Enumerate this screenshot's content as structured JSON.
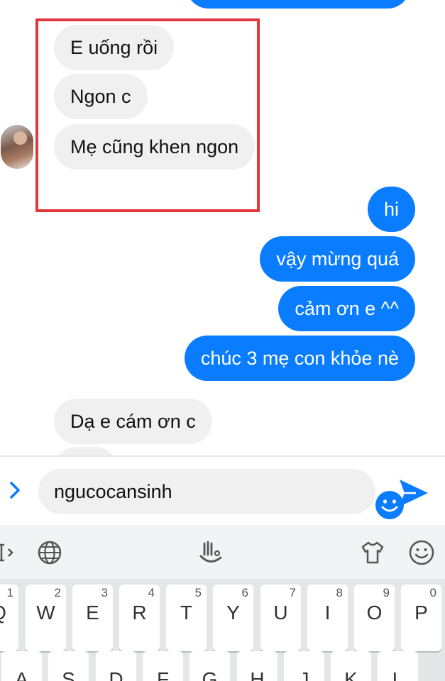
{
  "chat": {
    "incoming_top": [
      {
        "text": "E uống rồi"
      },
      {
        "text": "Ngon c"
      },
      {
        "text": "Mẹ cũng khen ngon"
      }
    ],
    "outgoing": [
      {
        "text": "hi"
      },
      {
        "text": "vậy mừng quá"
      },
      {
        "text": "cảm ơn e ^^"
      },
      {
        "text": "chúc 3 mẹ con khỏe nè"
      }
    ],
    "incoming_bottom": [
      {
        "text": "Dạ e cám ơn c"
      }
    ]
  },
  "composer": {
    "input_value": "ngucocansinh",
    "icons": [
      "chevron-right-icon",
      "emoji-icon",
      "send-icon"
    ]
  },
  "keyboard": {
    "toolbar_icons": [
      "cursor-icon",
      "globe-icon",
      "gesture-icon",
      "shirt-icon",
      "smiley-icon"
    ],
    "row1": [
      {
        "letter": "Q",
        "hint": "1"
      },
      {
        "letter": "W",
        "hint": "2"
      },
      {
        "letter": "E",
        "hint": "3"
      },
      {
        "letter": "R",
        "hint": "4"
      },
      {
        "letter": "T",
        "hint": "5"
      },
      {
        "letter": "Y",
        "hint": "6"
      },
      {
        "letter": "U",
        "hint": "7"
      },
      {
        "letter": "I",
        "hint": "8"
      },
      {
        "letter": "O",
        "hint": "9"
      },
      {
        "letter": "P",
        "hint": "0"
      }
    ],
    "row2": [
      {
        "letter": "A"
      },
      {
        "letter": "S"
      },
      {
        "letter": "D"
      },
      {
        "letter": "F"
      },
      {
        "letter": "G"
      },
      {
        "letter": "H"
      },
      {
        "letter": "J"
      },
      {
        "letter": "K"
      },
      {
        "letter": "L"
      }
    ]
  },
  "colors": {
    "accent": "#0a7cff",
    "incoming_bubble": "#f1f0f0",
    "highlight_border": "#e0373c"
  }
}
